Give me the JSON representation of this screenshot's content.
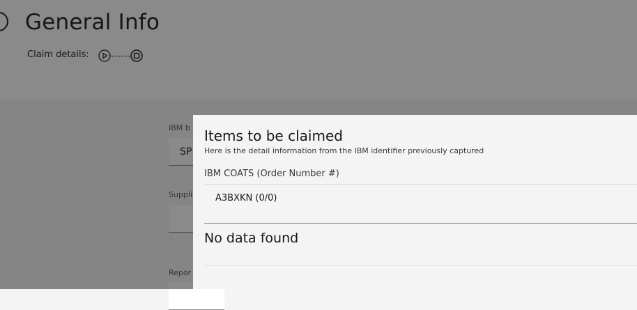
{
  "header": {
    "title": "General Info",
    "claim_label": "Claim details:"
  },
  "form": {
    "field1_label": "IBM b",
    "field1_value": "SP",
    "field2_label": "Suppli",
    "field3_label": "Repor"
  },
  "modal": {
    "title": "Items to be claimed",
    "subtitle": "Here is the detail information from the IBM identifier previously captured",
    "section_label": "IBM COATS (Order Number #)",
    "order_item": "A3BXKN (0/0)",
    "empty_message": "No data found"
  },
  "icons": {
    "back": "back-arrow-icon",
    "progress_start": "play-circle-icon",
    "progress_end": "stop-circle-icon"
  }
}
